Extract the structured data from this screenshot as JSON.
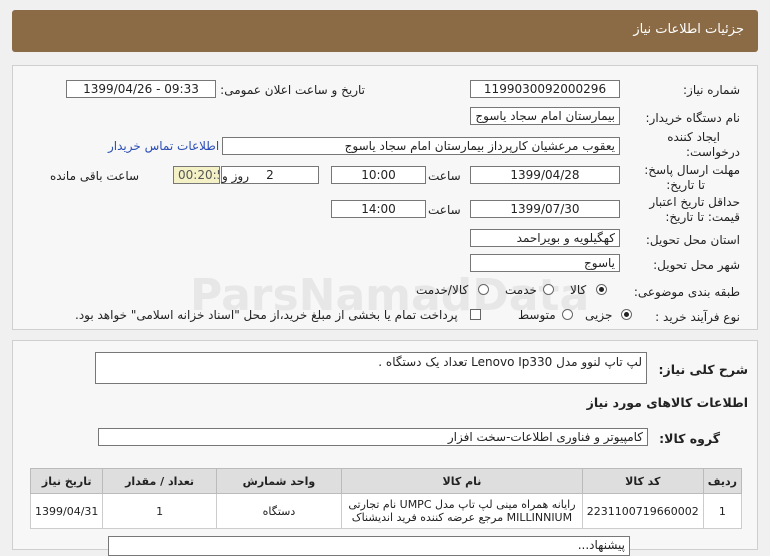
{
  "header": {
    "title": "جزئیات اطلاعات نیاز"
  },
  "fields": {
    "need_number_label": "شماره نیاز:",
    "need_number": "1199030092000296",
    "announce_label": "تاریخ و ساعت اعلان عمومی:",
    "announce_value": "1399/04/26 - 09:33",
    "buyer_label": "نام دستگاه خریدار:",
    "buyer": "بیمارستان امام سجاد یاسوج",
    "creator_label_1": "ایجاد کننده",
    "creator_label_2": "درخواست:",
    "creator": "یعقوب مرعشیان کارپرداز بیمارستان امام سجاد یاسوج",
    "contact_link": "اطلاعات تماس خریدار",
    "reply_label_1": "مهلت ارسال پاسخ:",
    "reply_label_2": "تا تاریخ:",
    "reply_date": "1399/04/28",
    "time_label": "ساعت",
    "reply_time": "10:00",
    "days": "2",
    "days_label": "روز و",
    "remaining": "00:20:55",
    "remaining_label": "ساعت باقی مانده",
    "validity_label_1": "حداقل تاریخ اعتبار",
    "validity_label_2": "قیمت: تا تاریخ:",
    "validity_date": "1399/07/30",
    "validity_time": "14:00",
    "province_label": "استان محل تحویل:",
    "province": "کهگیلویه و بویراحمد",
    "city_label": "شهر محل تحویل:",
    "city": "یاسوج",
    "category_label": "طبقه بندی موضوعی:",
    "cat_goods": "کالا",
    "cat_service": "خدمت",
    "cat_both": "کالا/خدمت",
    "process_label": "نوع فرآیند خرید :",
    "proc_partial": "جزیی",
    "proc_medium": "متوسط",
    "payment_note": "پرداخت تمام یا بخشی از مبلغ خرید،از محل \"اسناد خزانه اسلامی\" خواهد بود."
  },
  "summary": {
    "label": "شرح کلی نیاز:",
    "text": "لپ تاپ لنوو مدل Lenovo Ip330 تعداد یک دستگاه ."
  },
  "goods": {
    "section_title": "اطلاعات کالاهای مورد نیاز",
    "group_label": "گروه کالا:",
    "group_value": "کامپیوتر و فناوری اطلاعات-سخت افزار",
    "columns": [
      "ردیف",
      "کد کالا",
      "نام کالا",
      "واحد شمارش",
      "تعداد / مقدار",
      "تاریخ نیاز"
    ],
    "rows": [
      {
        "idx": "1",
        "code": "2231100719660002",
        "name_1": "رایانه همراه مینی لپ تاپ مدل UMPC نام تجارتی",
        "name_2": "MILLINNIUM مرجع عرضه کننده فرید اندیشناک",
        "unit": "دستگاه",
        "qty": "1",
        "date": "1399/04/31"
      }
    ],
    "footer_note": "پیشنهاد..."
  },
  "watermark": {
    "line1": "ParsNamadData",
    "line2": "پایگاه اطلاع رسانی مناقصه و مزایده",
    "line3": "۰۲۱-۸۸۳۴۹۶۷۰-۵"
  }
}
